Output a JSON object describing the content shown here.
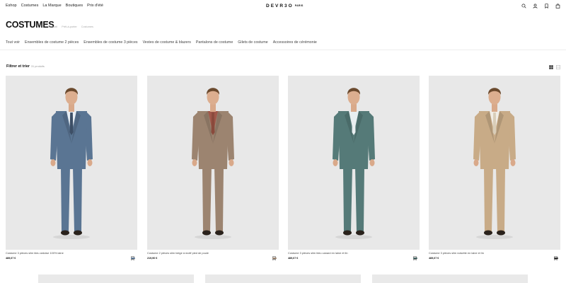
{
  "header": {
    "nav": [
      "Eshop",
      "Costumes",
      "La Marque",
      "Boutiques",
      "Prix d'été"
    ],
    "logo": "DEVR3O",
    "logo_sub": "PARIS",
    "icons": [
      "search-icon",
      "user-icon",
      "bookmark-icon",
      "shopping-bag-icon"
    ]
  },
  "page": {
    "title": "COSTUMES",
    "breadcrumb": [
      "Accueil",
      "Prêt-à-porter",
      "Costumes"
    ]
  },
  "categories": [
    "Tout voir",
    "Ensembles de costume 2 pièces",
    "Ensembles de costume 3 pièces",
    "Vestes de costume & blazers",
    "Pantalons de costume",
    "Gilets de costume",
    "Accessoires de cérémonie"
  ],
  "toolbar": {
    "filter_label": "Filtrer et trier",
    "count": "31 produits",
    "view_icons": [
      "grid-view-icon",
      "list-view-icon"
    ]
  },
  "products": [
    {
      "name": "Costume 3 pièces slim bleu ardoise 100% laine",
      "price": "489,07 €",
      "suit_color": "#5a7593",
      "shirt": "#e8eef4",
      "tie": "#3d4f66",
      "swatch": "#5a7593"
    },
    {
      "name": "Costume 2 pièces slim beige à motif pied de poule",
      "price": "219,90 €",
      "suit_color": "#9c8470",
      "shirt": "#a0584a",
      "tie": "#8a4a3c",
      "swatch": "#9c8470"
    },
    {
      "name": "Costume 3 pièces slim bleu canard en laine et lin",
      "price": "489,07 €",
      "suit_color": "#557a78",
      "shirt": "#e8eef0",
      "tie": "#e8eef0",
      "swatch": "#3f5f5e"
    },
    {
      "name": "Costume 3 pièces slim noisette en laine et lin",
      "price": "489,07 €",
      "suit_color": "#c8ab87",
      "shirt": "#f1ede6",
      "tie": "#d9cdb8",
      "swatch": "#2a2a2a"
    }
  ],
  "colors": {
    "photo_bg": "#e8e8e8",
    "text": "#111111",
    "muted": "#999999"
  }
}
